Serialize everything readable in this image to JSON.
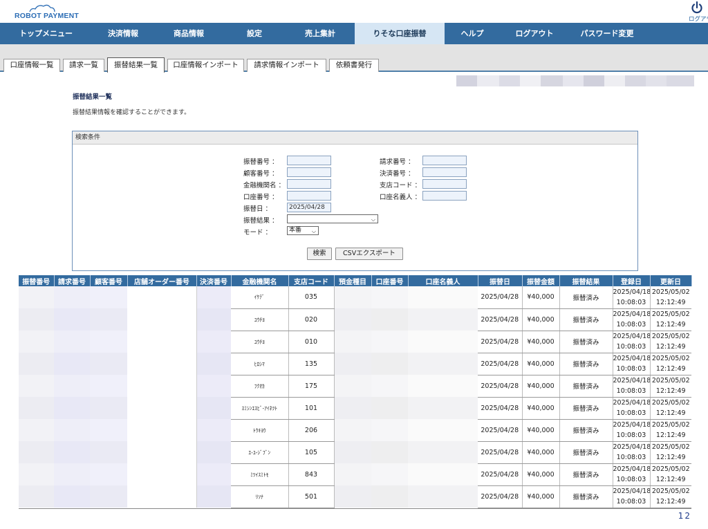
{
  "logo": {
    "text": "ROBOT PAYMENT"
  },
  "header": {
    "logout_label": "ログアウト"
  },
  "nav": [
    {
      "label": "トップメニュー",
      "active": false
    },
    {
      "label": "決済情報",
      "active": false
    },
    {
      "label": "商品情報",
      "active": false
    },
    {
      "label": "設定",
      "active": false
    },
    {
      "label": "売上集計",
      "active": false
    },
    {
      "label": "りそな口座振替",
      "active": true
    },
    {
      "label": "ヘルプ",
      "active": false
    },
    {
      "label": "ログアウト",
      "active": false
    },
    {
      "label": "パスワード変更",
      "active": false
    }
  ],
  "subtabs": [
    {
      "label": "口座情報一覧",
      "active": false
    },
    {
      "label": "請求一覧",
      "active": false
    },
    {
      "label": "振替結果一覧",
      "active": true
    },
    {
      "label": "口座情報インポート",
      "active": false
    },
    {
      "label": "請求情報インポート",
      "active": false
    },
    {
      "label": "依頼書発行",
      "active": false
    }
  ],
  "page": {
    "title": "振替結果一覧",
    "description": "振替結果情報を確認することができます。"
  },
  "search": {
    "header": "検索条件",
    "transfer_no_label": "振替番号 ：",
    "billing_no_label": "請求番号 ：",
    "customer_no_label": "顧客番号 ：",
    "payment_no_label": "決済番号 ：",
    "bank_name_label": "金融機関名 ：",
    "branch_code_label": "支店コード ：",
    "account_no_label": "口座番号 ：",
    "account_holder_label": "口座名義人 ：",
    "transfer_date_label": "振替日 ：",
    "transfer_date_value": "2025/04/28",
    "transfer_result_label": "振替結果 ：",
    "transfer_result_value": "",
    "mode_label": "モード ：",
    "mode_value": "本番",
    "search_button": "検索",
    "csv_button": "CSVエクスポート"
  },
  "table": {
    "headers": [
      "振替番号",
      "請求番号",
      "顧客番号",
      "店舗オーダー番号",
      "決済番号",
      "金融機関名",
      "支店コード",
      "預金種目",
      "口座番号",
      "口座名義人",
      "振替日",
      "振替金額",
      "振替結果",
      "登録日",
      "更新日"
    ],
    "rows": [
      {
        "bank": "ｲｹﾃﾞ",
        "branch": "035",
        "date": "2025/04/28",
        "amount": "¥40,000",
        "result": "振替済み",
        "reg_date": "2025/04/18",
        "reg_time": "10:08:03",
        "upd_date": "2025/05/02",
        "upd_time": "12:12:49"
      },
      {
        "bank": "ﾕｳﾁﾖ",
        "branch": "020",
        "date": "2025/04/28",
        "amount": "¥40,000",
        "result": "振替済み",
        "reg_date": "2025/04/18",
        "reg_time": "10:08:03",
        "upd_date": "2025/05/02",
        "upd_time": "12:12:49"
      },
      {
        "bank": "ﾕｳﾁﾖ",
        "branch": "010",
        "date": "2025/04/28",
        "amount": "¥40,000",
        "result": "振替済み",
        "reg_date": "2025/04/18",
        "reg_time": "10:08:03",
        "upd_date": "2025/05/02",
        "upd_time": "12:12:49"
      },
      {
        "bank": "ﾋﾛｼﾏ",
        "branch": "135",
        "date": "2025/04/28",
        "amount": "¥40,000",
        "result": "振替済み",
        "reg_date": "2025/04/18",
        "reg_time": "10:08:03",
        "upd_date": "2025/05/02",
        "upd_time": "12:12:49"
      },
      {
        "bank": "ﾌｸｵｶ",
        "branch": "175",
        "date": "2025/04/28",
        "amount": "¥40,000",
        "result": "振替済み",
        "reg_date": "2025/04/18",
        "reg_time": "10:08:03",
        "upd_date": "2025/05/02",
        "upd_time": "12:12:49"
      },
      {
        "bank": "ｽﾐｼﾝｴｽﾋﾞ-ｱｲﾈﾂﾄ",
        "branch": "101",
        "date": "2025/04/28",
        "amount": "¥40,000",
        "result": "振替済み",
        "reg_date": "2025/04/18",
        "reg_time": "10:08:03",
        "upd_date": "2025/05/02",
        "upd_time": "12:12:49"
      },
      {
        "bank": "ﾄｳｷﾖｳ",
        "branch": "206",
        "date": "2025/04/28",
        "amount": "¥40,000",
        "result": "振替済み",
        "reg_date": "2025/04/18",
        "reg_time": "10:08:03",
        "upd_date": "2025/05/02",
        "upd_time": "12:12:49"
      },
      {
        "bank": "ｴ-ﾕ-ｼﾞﾌﾞﾝ",
        "branch": "105",
        "date": "2025/04/28",
        "amount": "¥40,000",
        "result": "振替済み",
        "reg_date": "2025/04/18",
        "reg_time": "10:08:03",
        "upd_date": "2025/05/02",
        "upd_time": "12:12:49"
      },
      {
        "bank": "ﾐﾂｲｽﾐﾄﾓ",
        "branch": "843",
        "date": "2025/04/28",
        "amount": "¥40,000",
        "result": "振替済み",
        "reg_date": "2025/04/18",
        "reg_time": "10:08:03",
        "upd_date": "2025/05/02",
        "upd_time": "12:12:49"
      },
      {
        "bank": "ﾘｿﾅ",
        "branch": "501",
        "date": "2025/04/28",
        "amount": "¥40,000",
        "result": "振替済み",
        "reg_date": "2025/04/18",
        "reg_time": "10:08:03",
        "upd_date": "2025/05/02",
        "upd_time": "12:12:49"
      }
    ]
  },
  "pager": {
    "pages": [
      "1",
      "2"
    ],
    "current": "1"
  },
  "colors": {
    "nav_bg": "#336b9f",
    "nav_active_bg": "#d6e6f4",
    "accent": "#2c6db5"
  }
}
